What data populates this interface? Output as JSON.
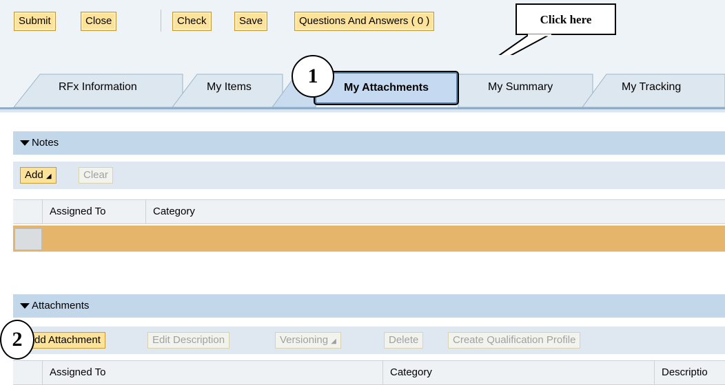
{
  "toolbar": {
    "submit": "Submit",
    "close": "Close",
    "check": "Check",
    "save": "Save",
    "qa": "Questions And Answers ( 0 )"
  },
  "callout": {
    "text": "Click here"
  },
  "steps": {
    "one": "1",
    "two": "2"
  },
  "tabs": {
    "rfx": "RFx Information",
    "items": "My Items",
    "attachments": "My Attachments",
    "summary": "My Summary",
    "tracking": "My Tracking"
  },
  "notes": {
    "title": "Notes",
    "add": "Add",
    "clear": "Clear",
    "col_assigned": "Assigned To",
    "col_category": "Category"
  },
  "attachments": {
    "title": "Attachments",
    "add_attachment": "Add Attachment",
    "edit_description": "Edit Description",
    "versioning": "Versioning",
    "delete": "Delete",
    "create_profile": "Create Qualification Profile",
    "col_assigned": "Assigned To",
    "col_category": "Category",
    "col_description": "Descriptio"
  },
  "colors": {
    "button_bg": "#fde39a",
    "tab_active": "#c5daf0",
    "section_head": "#c2d7ea",
    "row_highlight": "#e5b56c"
  }
}
